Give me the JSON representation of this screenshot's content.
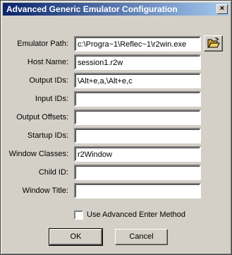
{
  "window": {
    "title": "Advanced Generic Emulator Configuration",
    "close_glyph": "×"
  },
  "fields": [
    {
      "label": "Emulator Path:",
      "value": "c:\\Progra~1\\Reflec~1\\r2win.exe"
    },
    {
      "label": "Host Name:",
      "value": "session1.r2w"
    },
    {
      "label": "Output IDs:",
      "value": "\\Alt+e,a,\\Alt+e,c"
    },
    {
      "label": "Input IDs:",
      "value": ""
    },
    {
      "label": "Output Offsets:",
      "value": ""
    },
    {
      "label": "Startup IDs:",
      "value": ""
    },
    {
      "label": "Window Classes:",
      "value": "r2Window"
    },
    {
      "label": "Child ID:",
      "value": ""
    },
    {
      "label": "Window Title:",
      "value": ""
    }
  ],
  "browse_icon": "open-folder-icon",
  "checkbox": {
    "label": "Use Advanced Enter Method",
    "checked": false
  },
  "buttons": {
    "ok": "OK",
    "cancel": "Cancel"
  },
  "colors": {
    "title_start": "#0a246a",
    "title_end": "#a6caf0",
    "face": "#d4d0c8"
  }
}
